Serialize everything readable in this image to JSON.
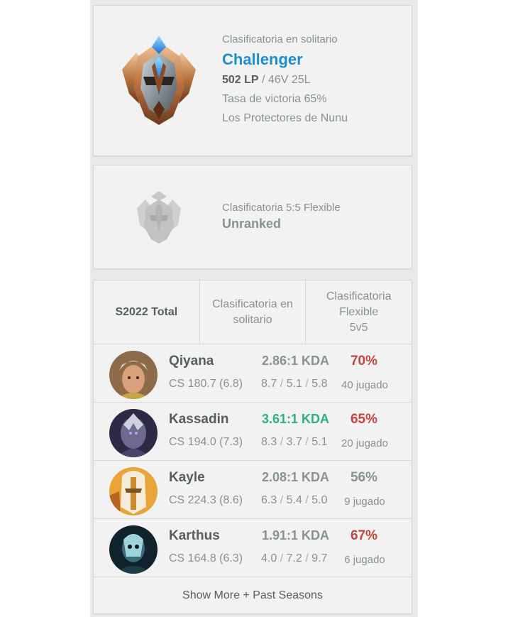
{
  "solo": {
    "queue": "Clasificatoria en solitario",
    "tier": "Challenger",
    "lp": "502 LP",
    "record": " / 46V 25L",
    "winrate": "Tasa de victoria 65%",
    "league": "Los Protectores de Nunu",
    "emblem_icon": "challenger-emblem-icon"
  },
  "flex": {
    "queue": "Clasificatoria 5:5 Flexible",
    "tier": "Unranked",
    "emblem_icon": "unranked-emblem-icon"
  },
  "champions": {
    "tabs": [
      "S2022 Total",
      "Clasificatoria en\nsolitario",
      "Clasificatoria\nFlexible\n5v5"
    ],
    "rows": [
      {
        "name": "Qiyana",
        "cs": "CS 180.7 (6.8)",
        "kda": "2.86:1 KDA",
        "k": "8.7",
        "d": "5.1",
        "a": "5.8",
        "winrate": "70%",
        "played": "40 jugado"
      },
      {
        "name": "Kassadin",
        "cs": "CS 194.0 (7.3)",
        "kda": "3.61:1 KDA",
        "k": "8.3",
        "d": "3.7",
        "a": "5.1",
        "winrate": "65%",
        "played": "20 jugado"
      },
      {
        "name": "Kayle",
        "cs": "CS 224.3 (8.6)",
        "kda": "2.08:1 KDA",
        "k": "6.3",
        "d": "5.4",
        "a": "5.0",
        "winrate": "56%",
        "played": "9 jugado"
      },
      {
        "name": "Karthus",
        "cs": "CS 164.8 (6.3)",
        "kda": "1.91:1 KDA",
        "k": "4.0",
        "d": "7.2",
        "a": "9.7",
        "winrate": "67%",
        "played": "6 jugado"
      }
    ],
    "more_label": "Show More + Past Seasons"
  },
  "colors": {
    "tier_blue": "#1f8ecd",
    "kda_green": "#2daf7f",
    "winrate_red": "#c6443e"
  }
}
